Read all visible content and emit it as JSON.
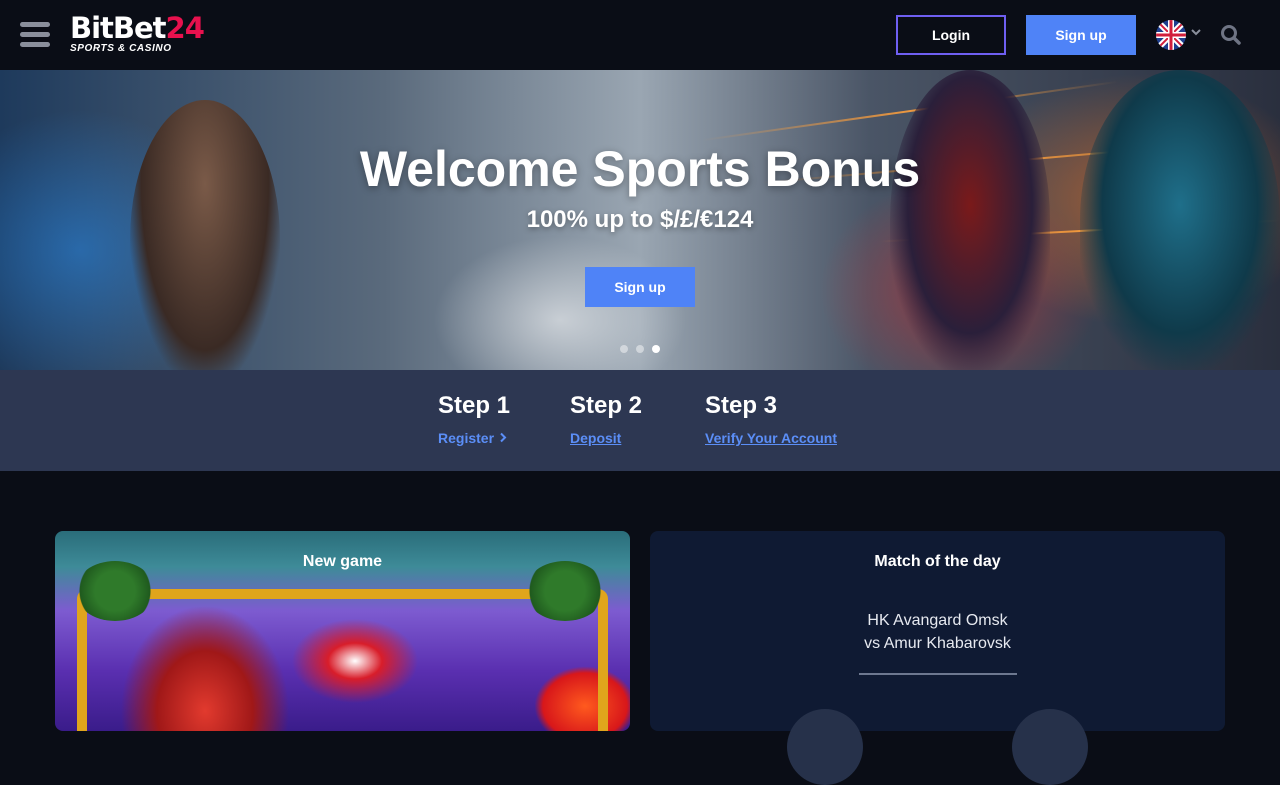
{
  "header": {
    "menu_icon": "hamburger-menu-icon",
    "logo": {
      "name_main": "BitBet",
      "name_accent": "24",
      "tagline": "SPORTS & CASINO"
    },
    "login_label": "Login",
    "signup_label": "Sign up",
    "language_icon": "uk-flag-icon",
    "search_icon": "search-icon"
  },
  "hero": {
    "title": "Welcome Sports Bonus",
    "subtitle": "100% up to $/£/€124",
    "button_label": "Sign up",
    "slides": {
      "count": 3,
      "active_index": 2
    }
  },
  "steps": [
    {
      "title": "Step 1",
      "link": "Register",
      "link_icon": "chevron-right-icon"
    },
    {
      "title": "Step 2",
      "link": "Deposit"
    },
    {
      "title": "Step 3",
      "link": "Verify Your Account"
    }
  ],
  "cards": {
    "new_game": {
      "title": "New game"
    },
    "match_of_day": {
      "title": "Match of the day",
      "team_home": "HK Avangard Omsk",
      "team_away": "vs Amur Khabarovsk"
    }
  },
  "colors": {
    "accent_blue": "#4f83f7",
    "login_border": "#6f5ff2",
    "logo_red": "#e8114e",
    "steps_bg": "#2d3752",
    "page_bg": "#0a0d16",
    "card_bg": "#0f1a33"
  }
}
